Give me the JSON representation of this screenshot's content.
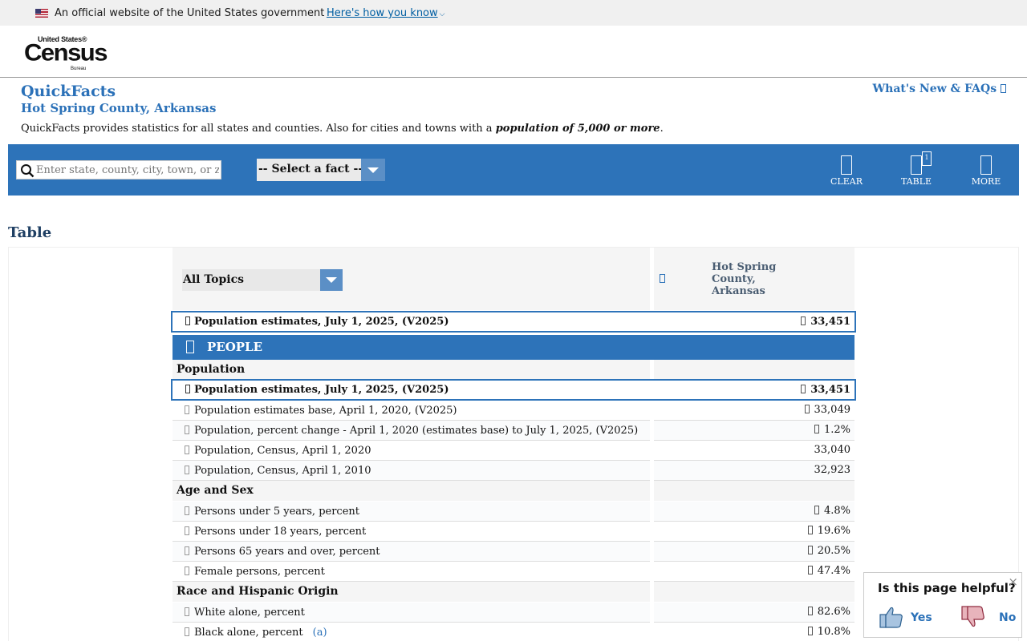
{
  "gov_banner": {
    "text": "An official website of the United States government",
    "link": "Here's how you know"
  },
  "logo": {
    "top": "United States®",
    "main": "Census",
    "sub": "Bureau"
  },
  "header": {
    "title": "QuickFacts",
    "location": "Hot Spring County, Arkansas",
    "description_pre": "QuickFacts provides statistics for all states and counties. Also for cities and towns with a ",
    "description_bold": "population of 5,000 or more",
    "description_post": ".",
    "whats_new": "What's New & FAQs"
  },
  "toolbar": {
    "search_placeholder": "Enter state, county, city, town, or zip code",
    "select_fact": "-- Select a fact --",
    "buttons": {
      "clear": "CLEAR",
      "table": "TABLE",
      "more": "MORE"
    },
    "table_badge": "1"
  },
  "table": {
    "heading": "Table",
    "topics_select": "All Topics",
    "location_column": "Hot Spring County, Arkansas",
    "highlight_top": {
      "label": "Population estimates, July 1, 2025, (V2025)",
      "value": "33,451"
    },
    "section": "PEOPLE",
    "groups": {
      "population": "Population",
      "age_sex": "Age and Sex",
      "race": "Race and Hispanic Origin"
    },
    "population_highlight": {
      "label": "Population estimates, July 1, 2025, (V2025)",
      "value": "33,451"
    },
    "population_rows": [
      {
        "label": "Population estimates base, April 1, 2020, (V2025)",
        "value": "33,049"
      },
      {
        "label": "Population, percent change - April 1, 2020 (estimates base) to July 1, 2025, (V2025)",
        "value": "1.2%"
      },
      {
        "label": "Population, Census, April 1, 2020",
        "value": "33,040"
      },
      {
        "label": "Population, Census, April 1, 2010",
        "value": "32,923"
      }
    ],
    "age_rows": [
      {
        "label": "Persons under 5 years, percent",
        "value": "4.8%"
      },
      {
        "label": "Persons under 18 years, percent",
        "value": "19.6%"
      },
      {
        "label": "Persons 65 years and over, percent",
        "value": "20.5%"
      },
      {
        "label": "Female persons, percent",
        "value": "47.4%"
      }
    ],
    "race_rows": [
      {
        "label": "White alone, percent",
        "value": "82.6%"
      },
      {
        "label": "Black alone, percent",
        "value": "10.8%",
        "footnote": "(a)"
      }
    ]
  },
  "feedback": {
    "question": "Is this page helpful?",
    "yes": "Yes",
    "no": "No",
    "close": "×"
  }
}
